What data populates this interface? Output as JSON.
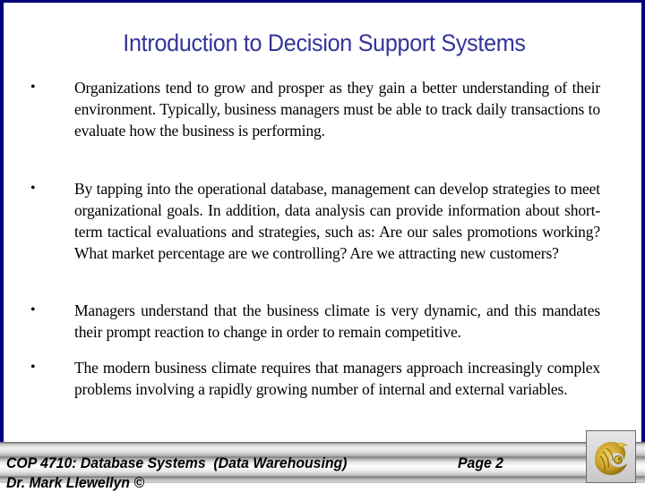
{
  "slide": {
    "title": "Introduction to Decision Support Systems",
    "bullets": [
      {
        "marker": "•",
        "text": "Organizations tend to grow and prosper as they gain a better understanding of their environment.  Typically, business managers must be able to track daily transactions to evaluate how the business is performing."
      },
      {
        "marker": "•",
        "text": "By tapping into the operational database, management can develop strategies to meet organizational goals.  In addition, data analysis can provide information about short-term tactical evaluations and strategies, such as: Are our sales promotions working?  What market percentage are we controlling? Are we attracting new customers?"
      },
      {
        "marker": "•",
        "text": "Managers understand that the business climate is very dynamic, and this mandates their prompt reaction to change in order to remain competitive."
      },
      {
        "marker": "•",
        "text": "The modern business climate requires that managers approach increasingly complex problems involving a rapidly growing number of internal and external variables."
      }
    ]
  },
  "footer": {
    "course": "COP 4710: Database Systems  (Data Warehousing)",
    "page": "Page 2",
    "author": "Dr. Mark Llewellyn ©",
    "logo_icon": "ucf-pegasus-logo"
  },
  "colors": {
    "frame_border": "#00007a",
    "title": "#333399",
    "logo_gold": "#c9a227"
  }
}
